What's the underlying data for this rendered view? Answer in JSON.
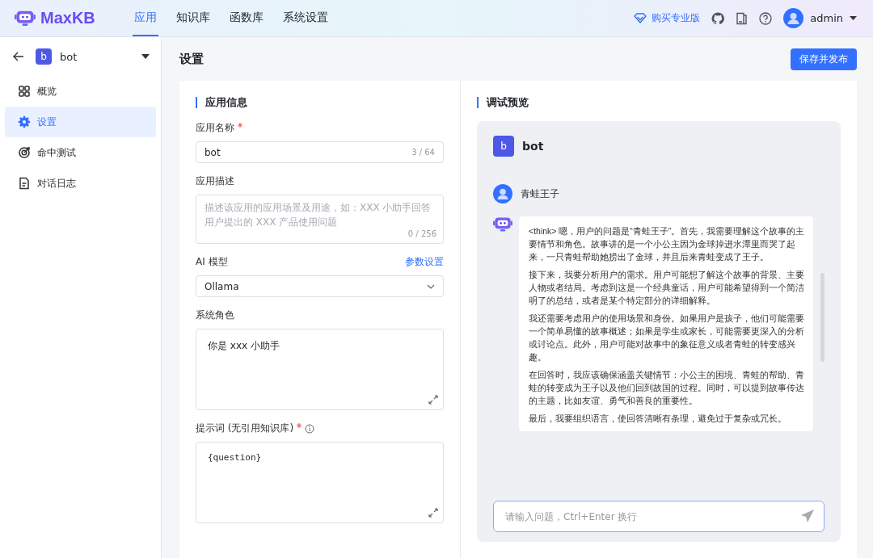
{
  "header": {
    "logo": "MaxKB",
    "nav": [
      {
        "label": "应用",
        "selected": true
      },
      {
        "label": "知识库",
        "selected": false
      },
      {
        "label": "函数库",
        "selected": false
      },
      {
        "label": "系统设置",
        "selected": false
      }
    ],
    "upgrade": "购买专业版",
    "user": "admin"
  },
  "sidebar": {
    "app_initial": "b",
    "app_name": "bot",
    "items": [
      {
        "label": "概览",
        "selected": false
      },
      {
        "label": "设置",
        "selected": true
      },
      {
        "label": "命中测试",
        "selected": false
      },
      {
        "label": "对话日志",
        "selected": false
      }
    ]
  },
  "page": {
    "title": "设置",
    "publish_button": "保存并发布"
  },
  "app_info": {
    "title": "应用信息",
    "fields": [
      {
        "kind": "input",
        "label": "应用名称",
        "required": true,
        "value": "bot",
        "counter": "3 / 64"
      },
      {
        "kind": "textarea",
        "label": "应用描述",
        "required": false,
        "placeholder": "描述该应用的应用场景及用途，如：XXX 小助手回答用户提出的 XXX 产品使用问题",
        "counter": "0 / 256"
      },
      {
        "kind": "select",
        "label": "AI 模型",
        "required": false,
        "link": "参数设置",
        "value": "Ollama"
      },
      {
        "kind": "editor",
        "label": "系统角色",
        "required": false,
        "value": "你是 xxx 小助手"
      },
      {
        "kind": "code_editor",
        "label": "提示词 (无引用知识库)",
        "required": true,
        "info": true,
        "value": "{question}"
      }
    ]
  },
  "preview": {
    "title": "调试预览",
    "bot_initial": "b",
    "bot_name": "bot",
    "user_message": "青蛙王子",
    "answer": [
      "<think> 嗯，用户的问题是“青蛙王子”。首先，我需要理解这个故事的主要情节和角色。故事讲的是一个小公主因为金球掉进水潭里而哭了起来，一只青蛙帮助她捞出了金球，并且后来青蛙变成了王子。",
      "接下来，我要分析用户的需求。用户可能想了解这个故事的背景、主要人物或者结局。考虑到这是一个经典童话，用户可能希望得到一个简洁明了的总结，或者是某个特定部分的详细解释。",
      "我还需要考虑用户的使用场景和身份。如果用户是孩子，他们可能需要一个简单易懂的故事概述；如果是学生或家长，可能需要更深入的分析或讨论点。此外，用户可能对故事中的象征意义或者青蛙的转变感兴趣。",
      "在回答时，我应该确保涵盖关键情节：小公主的困境、青蛙的帮助、青蛙的转变成为王子以及他们回到故国的过程。同时，可以提到故事传达的主题，比如友谊、勇气和善良的重要性。",
      "最后，我要组织语言，使回答清晰有条理，避免过于复杂或冗长。"
    ],
    "input_placeholder": "请输入问题，Ctrl+Enter 换行"
  }
}
